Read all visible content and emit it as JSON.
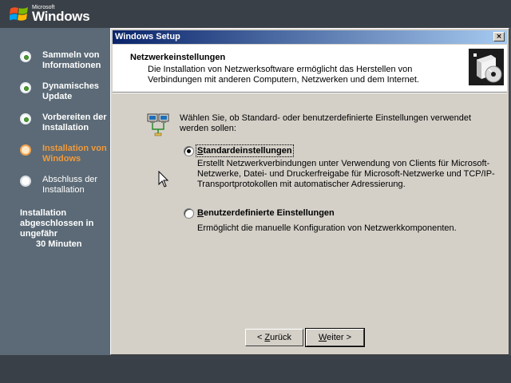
{
  "branding": {
    "microsoft": "Microsoft",
    "windows": "Windows"
  },
  "sidebar": {
    "steps": [
      {
        "label_line1": "Sammeln von",
        "label_line2": "Informationen",
        "state": "done"
      },
      {
        "label_line1": "Dynamisches",
        "label_line2": "Update",
        "state": "done"
      },
      {
        "label_line1": "Vorbereiten der",
        "label_line2": "Installation",
        "state": "done"
      },
      {
        "label_line1": "Installation von",
        "label_line2": "Windows",
        "state": "current"
      },
      {
        "label_line1": "Abschluss der",
        "label_line2": "Installation",
        "state": "pending"
      }
    ],
    "estimate_line1": "Installation",
    "estimate_line2": "abgeschlossen in",
    "estimate_line3": "ungefähr",
    "estimate_time": "30 Minuten"
  },
  "dialog": {
    "title": "Windows Setup",
    "close_glyph": "×",
    "header_title": "Netzwerkeinstellungen",
    "header_desc": "Die Installation von Netzwerksoftware ermöglicht das Herstellen von Verbindungen mit anderen Computern, Netzwerken und dem Internet.",
    "prompt": "Wählen Sie, ob Standard- oder benutzerdefinierte Einstellungen verwendet werden sollen:",
    "options": [
      {
        "label_accel": "S",
        "label_rest": "tandardeinstellungen",
        "desc": "Erstellt Netzwerkverbindungen unter Verwendung von Clients für Microsoft-Netzwerke, Datei- und Druckerfreigabe für Microsoft-Netzwerke und TCP/IP-Transportprotokollen mit automatischer Adressierung.",
        "selected": true
      },
      {
        "label_accel": "B",
        "label_rest": "enutzerdefinierte Einstellungen",
        "desc": "Ermöglicht die manuelle Konfiguration von Netzwerkkomponenten.",
        "selected": false
      }
    ],
    "back_prefix": "< ",
    "back_accel": "Z",
    "back_rest": "urück",
    "next_accel": "W",
    "next_rest": "eiter >"
  },
  "colors": {
    "accent_current": "#f29a3a",
    "done_dot": "#4a9d2f",
    "title_gradient_start": "#0a246a"
  }
}
